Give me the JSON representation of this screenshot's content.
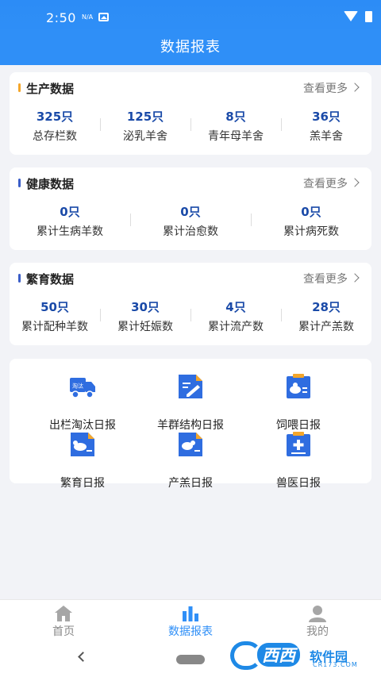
{
  "status_bar": {
    "time": "2:50",
    "network_label": "N/A"
  },
  "header": {
    "title": "数据报表"
  },
  "colors": {
    "primary": "#2f8ff7",
    "value_blue": "#1a4aa8",
    "production_accent": "#f4a62a",
    "health_accent": "#3b5ec8",
    "breeding_accent": "#3b5ec8"
  },
  "production": {
    "title": "生产数据",
    "more": "查看更多",
    "stats": [
      {
        "value": "325只",
        "label": "总存栏数"
      },
      {
        "value": "125只",
        "label": "泌乳羊舍"
      },
      {
        "value": "8只",
        "label": "青年母羊舍"
      },
      {
        "value": "36只",
        "label": "羔羊舍"
      }
    ]
  },
  "health": {
    "title": "健康数据",
    "more": "查看更多",
    "stats": [
      {
        "value": "0只",
        "label": "累计生病羊数"
      },
      {
        "value": "0只",
        "label": "累计治愈数"
      },
      {
        "value": "0只",
        "label": "累计病死数"
      }
    ]
  },
  "breeding": {
    "title": "繁育数据",
    "more": "查看更多",
    "stats": [
      {
        "value": "50只",
        "label": "累计配种羊数"
      },
      {
        "value": "30只",
        "label": "累计妊娠数"
      },
      {
        "value": "4只",
        "label": "累计流产数"
      },
      {
        "value": "28只",
        "label": "累计产羔数"
      }
    ]
  },
  "reports": [
    {
      "label": "出栏淘汰日报",
      "icon": "truck-icon",
      "icon_text": "淘汰"
    },
    {
      "label": "羊群结构日报",
      "icon": "edit-document-icon"
    },
    {
      "label": "饲喂日报",
      "icon": "feed-report-icon"
    },
    {
      "label": "繁育日报",
      "icon": "breeding-report-icon"
    },
    {
      "label": "产羔日报",
      "icon": "lambing-report-icon"
    },
    {
      "label": "兽医日报",
      "icon": "vet-report-icon"
    }
  ],
  "tabbar": {
    "tabs": [
      {
        "label": "首页",
        "icon": "home-icon",
        "active": false
      },
      {
        "label": "数据报表",
        "icon": "bar-chart-icon",
        "active": true
      },
      {
        "label": "我的",
        "icon": "user-icon",
        "active": false
      }
    ]
  },
  "watermark": {
    "brand": "西西",
    "sub": "软件园",
    "url": "CR173.COM"
  }
}
